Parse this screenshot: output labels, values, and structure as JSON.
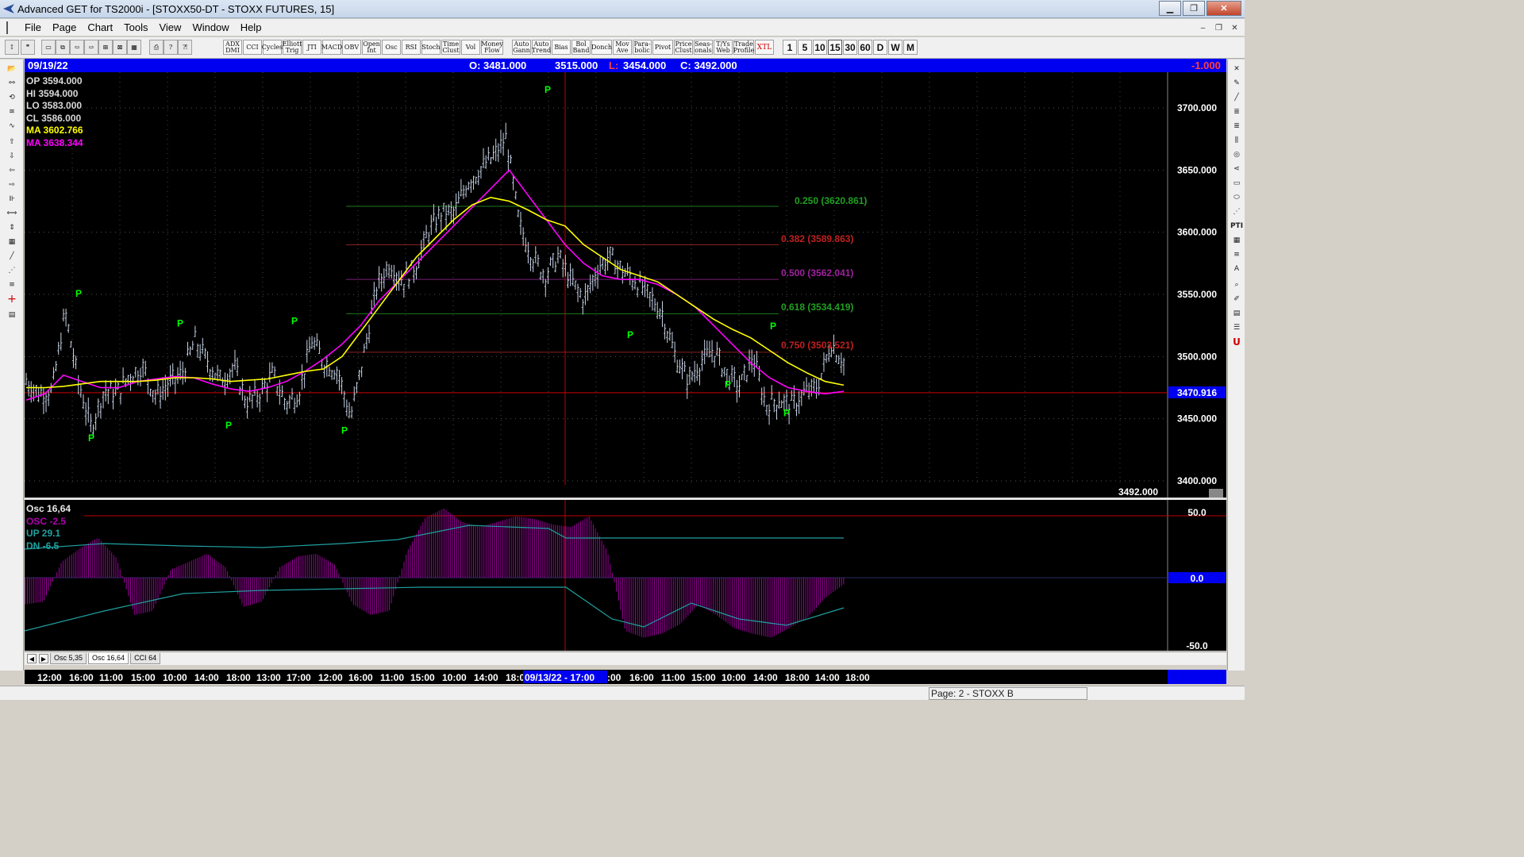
{
  "window": {
    "title": "Advanced GET for TS2000i - [STOXX50-DT - STOXX FUTURES, 15]"
  },
  "menu": [
    "File",
    "Page",
    "Chart",
    "Tools",
    "View",
    "Window",
    "Help"
  ],
  "toolbar": {
    "studies": [
      "ADX DMI",
      "CCI",
      "Cycles",
      "Elliott Trig",
      "JTI",
      "MACD",
      "OBV",
      "Open Int",
      "Osc",
      "RSI",
      "Stoch",
      "Time Clust",
      "Vol",
      "Money Flow",
      "Auto Gann",
      "Auto Trend",
      "Bias",
      "Bol Band",
      "Donch",
      "Mov Ave",
      "Para- bolic",
      "Pivot",
      "Price Clust",
      "Seas- onals",
      "T/Ys Web",
      "Trade Profile",
      "XTL"
    ],
    "intervals": [
      "1",
      "5",
      "10",
      "15",
      "30",
      "60",
      "D",
      "W",
      "M"
    ],
    "active_interval": "15"
  },
  "infobar": {
    "date": "09/19/22",
    "open": "O: 3481.000",
    "high": "3515.000",
    "low_label": "L:",
    "low": "3454.000",
    "close": "C: 3492.000",
    "change": "-1.000"
  },
  "legend": {
    "op": "OP  3594.000",
    "hi": "HI   3594.000",
    "lo": "LO  3583.000",
    "cl": "CL  3586.000",
    "ma1": "MA  3602.766",
    "ma2": "MA  3638.344"
  },
  "fib": {
    "l250": "0.250  (3620.861)",
    "l382": "0.382  (3589.863)",
    "l500": "0.500  (3562.041)",
    "l618": "0.618  (3534.419)",
    "l750": "0.750  (3503.521)"
  },
  "price_axis": {
    "ticks": [
      "3700.000",
      "3650.000",
      "3600.000",
      "3550.000",
      "3500.000",
      "3450.000",
      "3400.000"
    ],
    "current": "3470.916",
    "last": "3492.000"
  },
  "oscillator": {
    "title": "Osc 16,64",
    "osc": "OSC  -2.5",
    "up": "UP   29.1",
    "dn": "DN   -6.5",
    "ticks": [
      "50.0",
      "0.0",
      "-50.0"
    ]
  },
  "tabs": [
    "Osc 5,35",
    "Osc 16,64",
    "CCI 64"
  ],
  "time_axis": {
    "labels": [
      "12:00",
      "16:00",
      "11:00",
      "15:00",
      "10:00",
      "14:00",
      "18:00",
      "13:00",
      "17:00",
      "12:00",
      "16:00",
      "11:00",
      "15:00",
      "10:00",
      "14:00",
      "18:0",
      "09/13/22 - 17:00",
      ":00",
      "16:00",
      "11:00",
      "15:00",
      "10:00",
      "14:00",
      "18:00",
      "14:00",
      "18:00"
    ]
  },
  "pivot_marker": "P",
  "status": "Page: 2 - STOXX B",
  "colors": {
    "info_blue": "#0000f0",
    "ma_fast": "#ffff00",
    "ma_slow": "#ff00ff",
    "pivot": "#00ff00",
    "osc_up": "#20a0a0",
    "osc_bars": "#b000b0",
    "crosshair": "#c00000"
  },
  "chart_data": {
    "type": "line",
    "title": "STOXX50-DT - STOXX FUTURES, 15",
    "ylim": [
      3390,
      3725
    ],
    "price_path": [
      3480,
      3470,
      3472,
      3535,
      3480,
      3442,
      3472,
      3470,
      3485,
      3490,
      3468,
      3478,
      3485,
      3512,
      3495,
      3480,
      3492,
      3462,
      3470,
      3485,
      3462,
      3470,
      3512,
      3495,
      3488,
      3450,
      3500,
      3555,
      3575,
      3560,
      3572,
      3600,
      3615,
      3615,
      3640,
      3650,
      3660,
      3675,
      3605,
      3580,
      3565,
      3580,
      3560,
      3545,
      3570,
      3580,
      3568,
      3560,
      3548,
      3535,
      3500,
      3480,
      3495,
      3505,
      3485,
      3475,
      3500,
      3460,
      3465,
      3460,
      3470,
      3475,
      3510,
      3495
    ],
    "ma_fast": [
      3475,
      3475,
      3476,
      3478,
      3480,
      3480,
      3480,
      3481,
      3483,
      3483,
      3482,
      3480,
      3481,
      3482,
      3485,
      3488,
      3490,
      3500,
      3520,
      3540,
      3560,
      3580,
      3595,
      3610,
      3622,
      3628,
      3625,
      3618,
      3610,
      3605,
      3590,
      3580,
      3570,
      3565,
      3560,
      3550,
      3540,
      3530,
      3522,
      3515,
      3505,
      3495,
      3487,
      3480,
      3477
    ],
    "ma_slow": [
      3465,
      3470,
      3485,
      3480,
      3475,
      3475,
      3480,
      3482,
      3484,
      3483,
      3478,
      3474,
      3472,
      3475,
      3480,
      3488,
      3498,
      3510,
      3525,
      3545,
      3560,
      3575,
      3590,
      3605,
      3620,
      3635,
      3650,
      3630,
      3610,
      3590,
      3575,
      3565,
      3562,
      3562,
      3558,
      3550,
      3540,
      3525,
      3510,
      3495,
      3483,
      3475,
      3472,
      3470,
      3472
    ],
    "fib_levels": [
      {
        "ratio": 0.25,
        "price": 3620.861
      },
      {
        "ratio": 0.382,
        "price": 3589.863
      },
      {
        "ratio": 0.5,
        "price": 3562.041
      },
      {
        "ratio": 0.618,
        "price": 3534.419
      },
      {
        "ratio": 0.75,
        "price": 3503.521
      }
    ],
    "horizontal_line": 3470.916
  }
}
